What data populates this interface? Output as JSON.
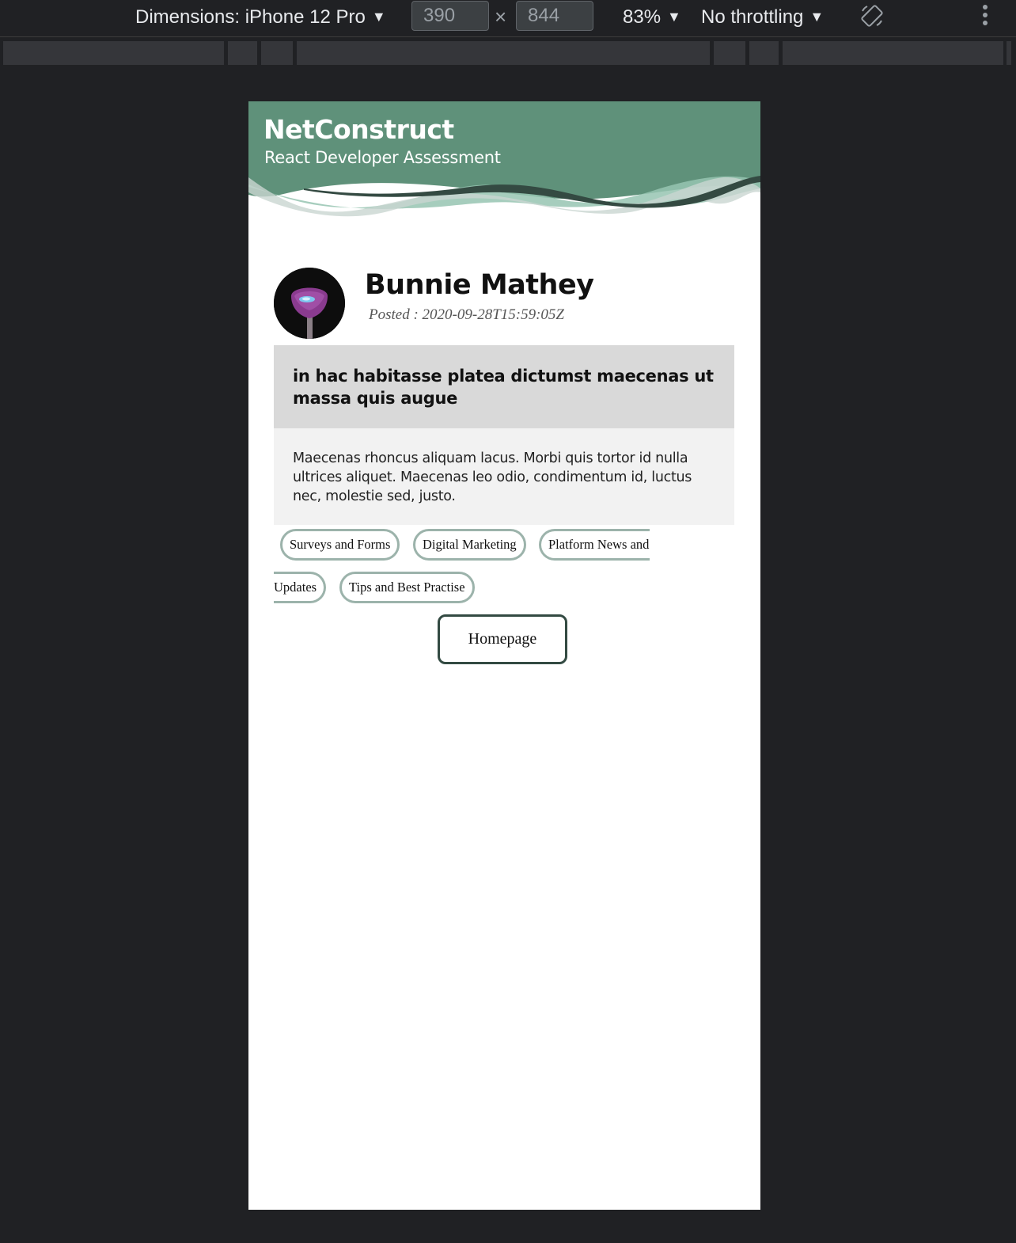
{
  "devtools": {
    "device_label": "Dimensions: iPhone 12 Pro",
    "width_value": "390",
    "height_value": "844",
    "times": "×",
    "zoom": "83%",
    "throttling": "No throttling",
    "caret": "▼"
  },
  "header": {
    "title": "NetConstruct",
    "subtitle": "React Developer Assessment"
  },
  "post": {
    "author": "Bunnie Mathey",
    "posted": "Posted : 2020-09-28T15:59:05Z",
    "title": "in hac habitasse platea dictumst maecenas ut massa quis augue",
    "body": "Maecenas rhoncus aliquam lacus. Morbi quis tortor id nulla ultrices aliquet. Maecenas leo odio, condimentum id, luctus nec, molestie sed, justo."
  },
  "tags": {
    "t1": "Surveys and Forms",
    "t2": "Digital Marketing",
    "t3a": "Platform News and",
    "t3b": "Updates",
    "t4": "Tips and Best Practise"
  },
  "homepage_button": "Homepage",
  "colors": {
    "header_green": "#5f917a",
    "wave_light": "#97c4b2",
    "wave_dark": "#344a42",
    "tag_border": "#9cb3ab",
    "button_border": "#334a42"
  },
  "icons": [
    "rotate-icon",
    "more-options-icon"
  ]
}
